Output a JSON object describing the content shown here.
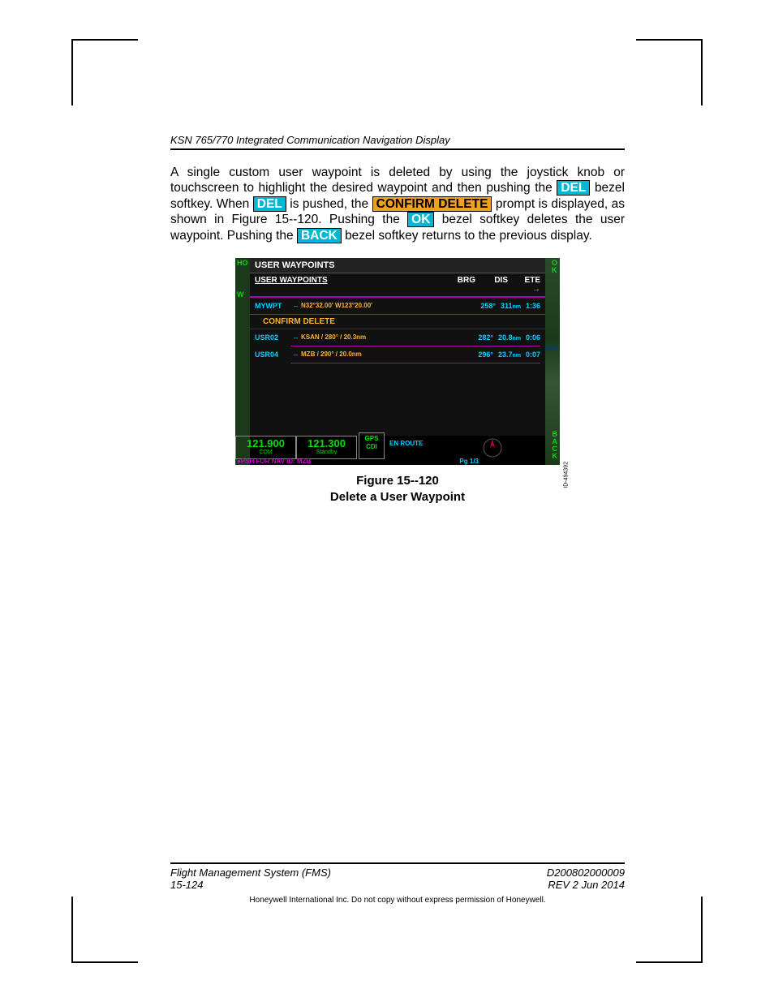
{
  "header": {
    "title": "KSN 765/770 Integrated Communication Navigation Display"
  },
  "body": {
    "p1a": "A single custom user waypoint is deleted by using the joystick knob or touchscreen to highlight the desired waypoint and then pushing the ",
    "del": "DEL",
    "p1b": " bezel softkey. When ",
    "p1c": " is pushed, the ",
    "confirm": "CONFIRM DELETE",
    "p1d": " prompt is displayed, as shown in Figure 15--120. Pushing the ",
    "ok": "OK",
    "p1e": " bezel softkey deletes the user waypoint. Pushing the ",
    "back": "BACK",
    "p1f": " bezel softkey returns to the previous display."
  },
  "screen": {
    "hoi": "HO",
    "w": "W",
    "title": "USER WAYPOINTS",
    "subtitle": "USER WAYPOINTS",
    "col_brg": "BRG",
    "col_dis": "DIS",
    "col_ete": "ETE",
    "row1": {
      "id": "MYWPT",
      "desc": "N32°32.00'  W123°20.00'",
      "brg": "258°",
      "dis": "311",
      "unit": "nm",
      "ete": "1:36"
    },
    "confirm": "CONFIRM DELETE",
    "row2": {
      "id": "USR02",
      "desc": "KSAN / 280° / 20.3nm",
      "brg": "282°",
      "dis": "20.8",
      "unit": "nm",
      "ete": "0:06"
    },
    "row3": {
      "id": "USR04",
      "desc": "MZB / 290° / 20.0nm",
      "brg": "296°",
      "dis": "23.7",
      "unit": "nm",
      "ete": "0:07"
    },
    "com_active": "121.900",
    "com_active_lbl": "COM",
    "com_standby": "121.300",
    "com_standby_lbl": "Standby",
    "gps": "GPS",
    "cdi": "CDI",
    "enroute": "EN ROUTE",
    "psh": "●PSH FOR NAV  ID: MZB",
    "pg": "Pg 1/3",
    "ok_side": "O\nK",
    "back_side": "B\nA\nC\nK",
    "nkx": "NKX",
    "idnum": "ID-494392"
  },
  "caption": {
    "line1": "Figure 15--120",
    "line2": "Delete a User Waypoint"
  },
  "footer": {
    "left1": "Flight Management System (FMS)",
    "left2": "15-124",
    "right1": "D200802000009",
    "right2": "REV 2   Jun 2014",
    "copy": "Honeywell International Inc. Do not copy without express permission of Honeywell."
  }
}
